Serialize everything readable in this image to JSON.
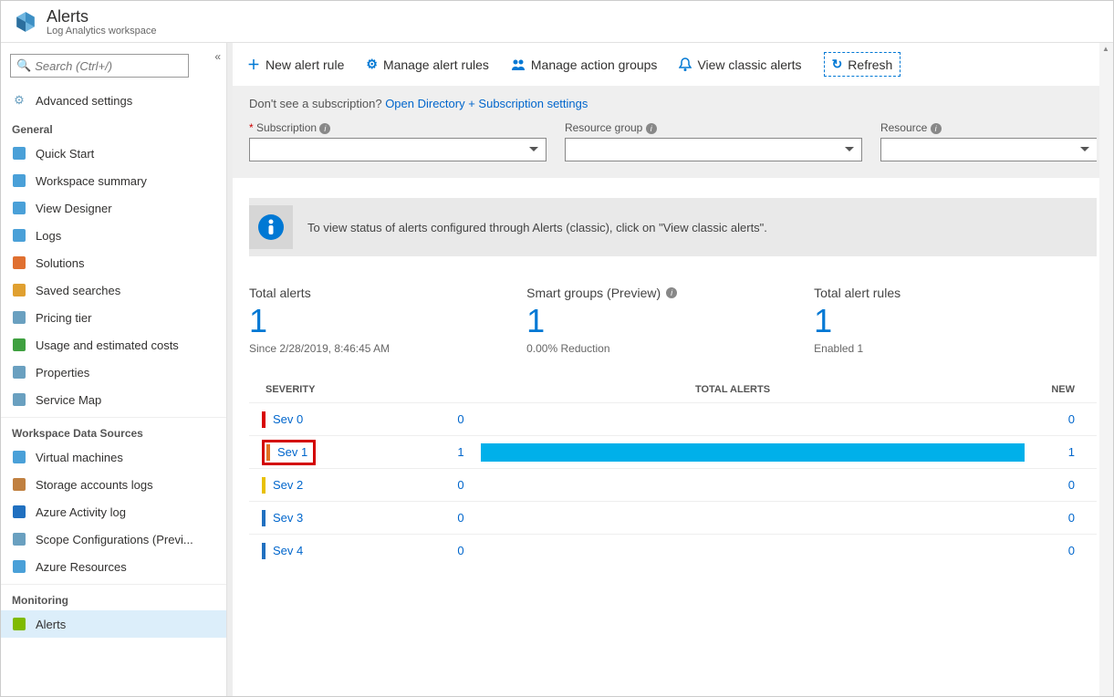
{
  "header": {
    "title": "Alerts",
    "subtitle": "Log Analytics workspace"
  },
  "search": {
    "placeholder": "Search (Ctrl+/)"
  },
  "sidebar": {
    "advanced": "Advanced settings",
    "groups": [
      {
        "label": "General",
        "items": [
          {
            "label": "Quick Start",
            "color": "#4aa0d8"
          },
          {
            "label": "Workspace summary",
            "color": "#4aa0d8"
          },
          {
            "label": "View Designer",
            "color": "#4aa0d8"
          },
          {
            "label": "Logs",
            "color": "#4aa0d8"
          },
          {
            "label": "Solutions",
            "color": "#e07030"
          },
          {
            "label": "Saved searches",
            "color": "#e0a030"
          },
          {
            "label": "Pricing tier",
            "color": "#6aa0c0"
          },
          {
            "label": "Usage and estimated costs",
            "color": "#3fa040"
          },
          {
            "label": "Properties",
            "color": "#6aa0c0"
          },
          {
            "label": "Service Map",
            "color": "#6aa0c0"
          }
        ]
      },
      {
        "label": "Workspace Data Sources",
        "items": [
          {
            "label": "Virtual machines",
            "color": "#4aa0d8"
          },
          {
            "label": "Storage accounts logs",
            "color": "#c08040"
          },
          {
            "label": "Azure Activity log",
            "color": "#2070c0"
          },
          {
            "label": "Scope Configurations (Previ...",
            "color": "#6aa0c0"
          },
          {
            "label": "Azure Resources",
            "color": "#4aa0d8"
          }
        ]
      },
      {
        "label": "Monitoring",
        "items": [
          {
            "label": "Alerts",
            "color": "#7fba00",
            "active": true
          }
        ]
      }
    ]
  },
  "toolbar": {
    "new": "New alert rule",
    "manage": "Manage alert rules",
    "groups": "Manage action groups",
    "classic": "View classic alerts",
    "refresh": "Refresh"
  },
  "filterbar": {
    "hint_pre": "Don't see a subscription? ",
    "hint_link": "Open Directory + Subscription settings",
    "subscription": "Subscription",
    "resource_group": "Resource group",
    "resource": "Resource"
  },
  "banner": "To view status of alerts configured through Alerts (classic), click on \"View classic alerts\".",
  "stats": {
    "total": {
      "label": "Total alerts",
      "value": "1",
      "sub": "Since 2/28/2019, 8:46:45 AM"
    },
    "smart": {
      "label": "Smart groups (Preview)",
      "value": "1",
      "sub": "0.00% Reduction"
    },
    "rules": {
      "label": "Total alert rules",
      "value": "1",
      "sub": "Enabled 1"
    }
  },
  "table": {
    "headers": {
      "sev": "SEVERITY",
      "total": "TOTAL ALERTS",
      "new": "NEW"
    },
    "rows": [
      {
        "label": "Sev 0",
        "tick": "#d80000",
        "total": "0",
        "new": "0",
        "bar": false,
        "hl": false
      },
      {
        "label": "Sev 1",
        "tick": "#e07020",
        "total": "1",
        "new": "1",
        "bar": true,
        "hl": true
      },
      {
        "label": "Sev 2",
        "tick": "#e8c000",
        "total": "0",
        "new": "0",
        "bar": false,
        "hl": false
      },
      {
        "label": "Sev 3",
        "tick": "#2070c0",
        "total": "0",
        "new": "0",
        "bar": false,
        "hl": false
      },
      {
        "label": "Sev 4",
        "tick": "#2070c0",
        "total": "0",
        "new": "0",
        "bar": false,
        "hl": false
      }
    ]
  }
}
